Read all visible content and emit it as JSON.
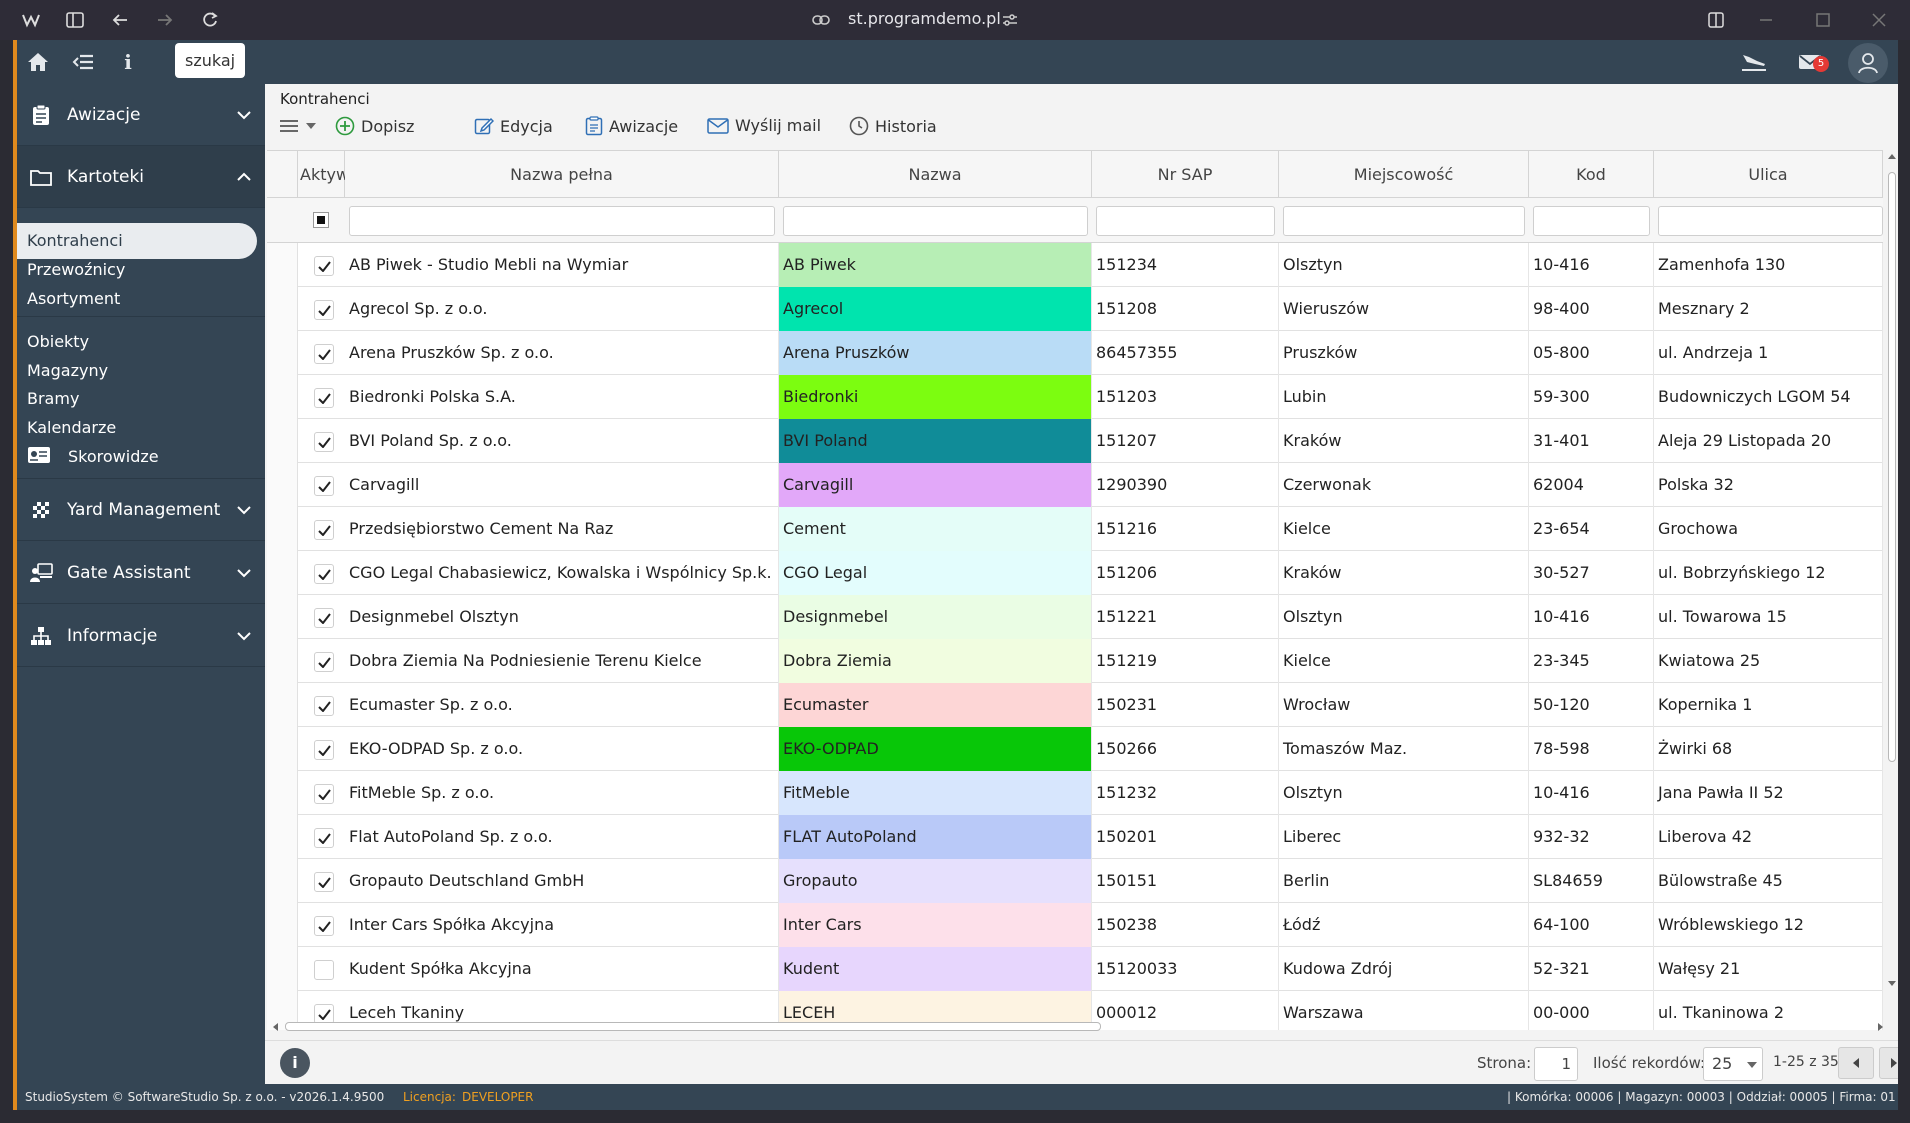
{
  "browser": {
    "url": "st.programdemo.pl"
  },
  "topbar": {
    "search_label": "szukaj",
    "mail_count": "5"
  },
  "sidebar": {
    "sections": [
      {
        "label": "Awizacje"
      },
      {
        "label": "Kartoteki"
      },
      {
        "label": "Yard Management"
      },
      {
        "label": "Gate Assistant"
      },
      {
        "label": "Informacje"
      }
    ],
    "kartoteki_items": [
      "Kontrahenci",
      "Przewoźnicy",
      "Asortyment"
    ],
    "obiekty_items": [
      "Obiekty",
      "Magazyny",
      "Bramy",
      "Kalendarze"
    ],
    "skorowidze": "Skorowidze"
  },
  "content": {
    "breadcrumb": "Kontrahenci",
    "toolbar": {
      "add": "Dopisz",
      "edit": "Edycja",
      "notices": "Awizacje",
      "send_mail": "Wyślij mail",
      "history": "Historia"
    }
  },
  "table": {
    "columns": [
      "Aktywne",
      "Nazwa pełna",
      "Nazwa",
      "Nr SAP",
      "Miejscowość",
      "Kod",
      "Ulica"
    ],
    "rows": [
      {
        "active": true,
        "full": "AB Piwek - Studio Mebli na Wymiar",
        "name": "AB Piwek",
        "color": "#b7eeb5",
        "sap": "151234",
        "city": "Olsztyn",
        "code": "10-416",
        "street": "Zamenhofa 130"
      },
      {
        "active": true,
        "full": "Agrecol Sp. z o.o.",
        "name": "Agrecol",
        "color": "#00e4ae",
        "sap": "151208",
        "city": "Wieruszów",
        "code": "98-400",
        "street": "Mesznary 2"
      },
      {
        "active": true,
        "full": "Arena Pruszków Sp. z o.o.",
        "name": "Arena Pruszków",
        "color": "#b9dcf6",
        "sap": "86457355",
        "city": "Pruszków",
        "code": "05-800",
        "street": "ul. Andrzeja 1"
      },
      {
        "active": true,
        "full": "Biedronki Polska S.A.",
        "name": "Biedronki",
        "color": "#7cfd10",
        "sap": "151203",
        "city": "Lubin",
        "code": "59-300",
        "street": "Budowniczych LGOM 54"
      },
      {
        "active": true,
        "full": "BVI Poland Sp. z o.o.",
        "name": "BVI Poland",
        "color": "#108c98",
        "sap": "151207",
        "city": "Kraków",
        "code": "31-401",
        "street": "Aleja 29 Listopada 20"
      },
      {
        "active": true,
        "full": "Carvagill",
        "name": "Carvagill",
        "color": "#e2a8f9",
        "sap": "1290390",
        "city": "Czerwonak",
        "code": "62004",
        "street": "Polska 32"
      },
      {
        "active": true,
        "full": "Przedsiębiorstwo Cement Na Raz",
        "name": "Cement",
        "color": "#e4fdf8",
        "sap": "151216",
        "city": "Kielce",
        "code": "23-654",
        "street": "Grochowa"
      },
      {
        "active": true,
        "full": "CGO Legal Chabasiewicz, Kowalska i Wspólnicy Sp.k.",
        "name": "CGO Legal",
        "color": "#e3fdfd",
        "sap": "151206",
        "city": "Kraków",
        "code": "30-527",
        "street": "ul. Bobrzyńskiego 12"
      },
      {
        "active": true,
        "full": "Designmebel Olsztyn",
        "name": "Designmebel",
        "color": "#eafde4",
        "sap": "151221",
        "city": "Olsztyn",
        "code": "10-416",
        "street": "ul. Towarowa 15"
      },
      {
        "active": true,
        "full": "Dobra Ziemia Na Podniesienie Terenu Kielce",
        "name": "Dobra Ziemia",
        "color": "#f1fde0",
        "sap": "151219",
        "city": "Kielce",
        "code": "23-345",
        "street": "Kwiatowa 25"
      },
      {
        "active": true,
        "full": "Ecumaster Sp. z o.o.",
        "name": "Ecumaster",
        "color": "#fdd6d6",
        "sap": "150231",
        "city": "Wrocław",
        "code": "50-120",
        "street": "Kopernika 1"
      },
      {
        "active": true,
        "full": "EKO-ODPAD Sp. z o.o.",
        "name": "EKO-ODPAD",
        "color": "#08c708",
        "sap": "150266",
        "city": "Tomaszów Maz.",
        "code": "78-598",
        "street": "Żwirki 68"
      },
      {
        "active": true,
        "full": "FitMeble Sp. z o.o.",
        "name": "FitMeble",
        "color": "#d7e6fd",
        "sap": "151232",
        "city": "Olsztyn",
        "code": "10-416",
        "street": "Jana Pawła II 52"
      },
      {
        "active": true,
        "full": "Flat AutoPoland Sp. z o.o.",
        "name": "FLAT AutoPoland",
        "color": "#b9c9f8",
        "sap": "150201",
        "city": "Liberec",
        "code": "932-32",
        "street": "Liberova 42"
      },
      {
        "active": true,
        "full": "Gropauto Deutschland GmbH",
        "name": "Gropauto",
        "color": "#e6e0fd",
        "sap": "150151",
        "city": "Berlin",
        "code": "SL84659",
        "street": "Bülowstraße 45"
      },
      {
        "active": true,
        "full": "Inter Cars Spółka Akcyjna",
        "name": "Inter Cars",
        "color": "#fde0ea",
        "sap": "150238",
        "city": "Łódź",
        "code": "64-100",
        "street": "Wróblewskiego 12"
      },
      {
        "active": false,
        "full": "Kudent Spółka Akcyjna",
        "name": "Kudent",
        "color": "#e7d6fd",
        "sap": "15120033",
        "city": "Kudowa Zdrój",
        "code": "52-321",
        "street": "Wałęsy 21"
      },
      {
        "active": true,
        "full": "Leceh Tkaniny",
        "name": "LECEH",
        "color": "#fdf3e2",
        "sap": "000012",
        "city": "Warszawa",
        "code": "00-000",
        "street": "ul. Tkaninowa 2"
      }
    ]
  },
  "pager": {
    "page_label": "Strona:",
    "page": "1",
    "count_label": "Ilość rekordów:",
    "per_page": "25",
    "range": "1-25 z 35"
  },
  "status": {
    "left": "StudioSystem © SoftwareStudio Sp. z o.o. - v2026.1.4.9500",
    "license_label": "Licencja:",
    "license_value": "DEVELOPER",
    "right": "| Komórka: 00006 | Magazyn: 00003 | Oddział: 00005 | Firma: 01"
  }
}
